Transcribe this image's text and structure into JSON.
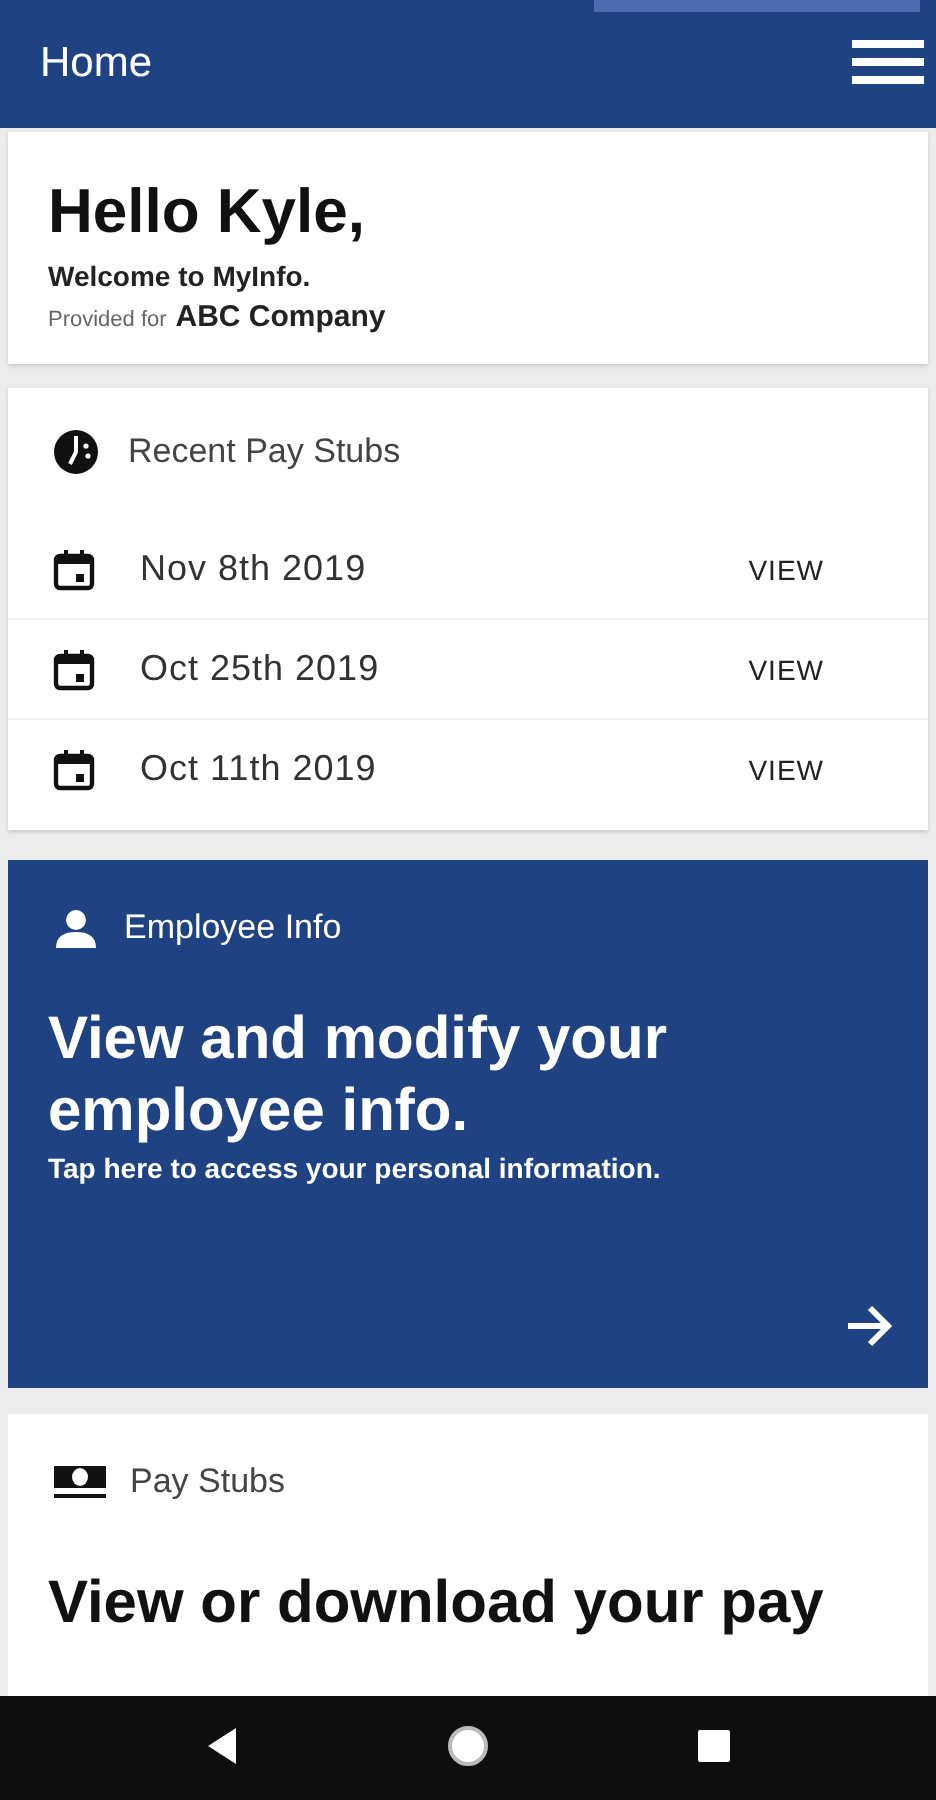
{
  "header": {
    "title": "Home"
  },
  "greeting": {
    "title": "Hello Kyle,",
    "welcome": "Welcome to MyInfo.",
    "provided_label": "Provided for",
    "company": "ABC Company"
  },
  "recent_pay_stubs": {
    "title": "Recent Pay Stubs",
    "rows": [
      {
        "date": "Nov 8th 2019",
        "action": "VIEW"
      },
      {
        "date": "Oct 25th 2019",
        "action": "VIEW"
      },
      {
        "date": "Oct 11th 2019",
        "action": "VIEW"
      }
    ]
  },
  "employee_info": {
    "title": "Employee Info",
    "headline": "View and modify your employee info.",
    "subtitle": "Tap here to access your personal information."
  },
  "pay_stubs": {
    "title": "Pay Stubs",
    "headline": "View or download your pay"
  }
}
